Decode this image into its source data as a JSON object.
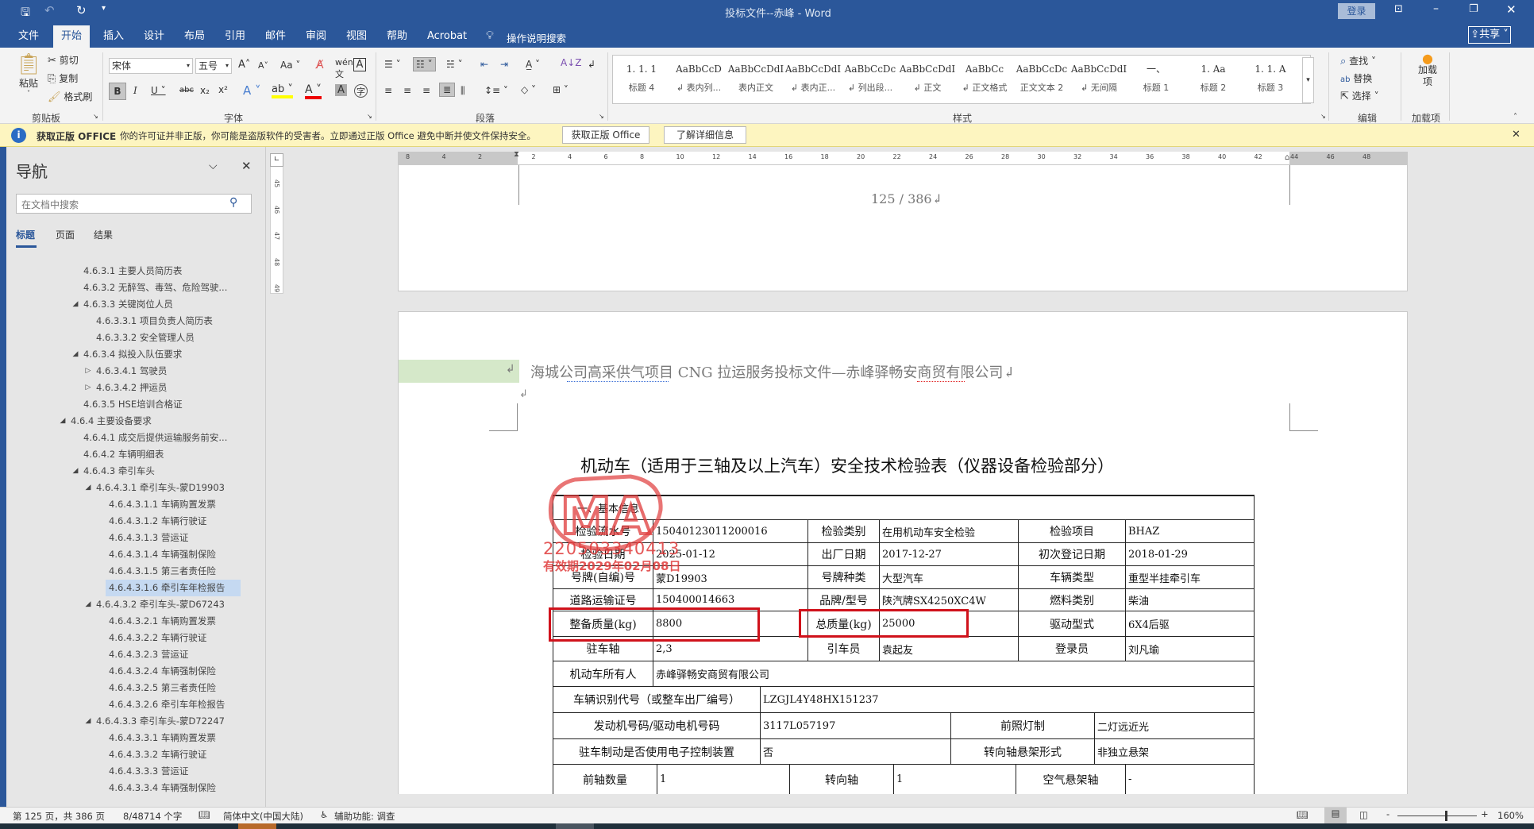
{
  "window": {
    "title": "投标文件--赤峰  -  Word",
    "login": "登录",
    "share": "共享"
  },
  "qat": {
    "save": "save-icon",
    "undo": "undo-icon",
    "redo": "redo-icon"
  },
  "tabs": [
    "文件",
    "开始",
    "插入",
    "设计",
    "布局",
    "引用",
    "邮件",
    "审阅",
    "视图",
    "帮助",
    "Acrobat"
  ],
  "tell_me": "操作说明搜索",
  "ribbon": {
    "clipboard": {
      "paste": "粘贴",
      "cut": "剪切",
      "copy": "复制",
      "format_painter": "格式刷",
      "label": "剪贴板"
    },
    "font": {
      "name": "宋体",
      "size": "五号",
      "label": "字体",
      "change_case": "Aa"
    },
    "paragraph": {
      "label": "段落"
    },
    "styles": {
      "label": "样式",
      "items": [
        {
          "preview": "1. 1. 1",
          "name": "标题 4"
        },
        {
          "preview": "AaBbCcD",
          "name": "↲ 表内列..."
        },
        {
          "preview": "AaBbCcDdI",
          "name": "表内正文"
        },
        {
          "preview": "AaBbCcDdI",
          "name": "↲ 表内正..."
        },
        {
          "preview": "AaBbCcDc",
          "name": "↲ 列出段..."
        },
        {
          "preview": "AaBbCcDdI",
          "name": "↲ 正文"
        },
        {
          "preview": "AaBbCc",
          "name": "↲ 正文格式"
        },
        {
          "preview": "AaBbCcDc",
          "name": "正文文本 2"
        },
        {
          "preview": "AaBbCcDdI",
          "name": "↲ 无间隔"
        },
        {
          "preview": "一、",
          "name": "标题 1"
        },
        {
          "preview": "1.  Aa",
          "name": "标题 2"
        },
        {
          "preview": "1. 1.  A",
          "name": "标题 3"
        }
      ]
    },
    "editing": {
      "find": "查找",
      "replace": "替换",
      "select": "选择",
      "label": "编辑"
    },
    "addins": {
      "button": "加载项",
      "label": "加载项"
    }
  },
  "infobar": {
    "title": "获取正版 OFFICE",
    "message": "你的许可证并非正版，你可能是盗版软件的受害者。立即通过正版 Office 避免中断并使文件保持安全。",
    "btn_get": "获取正版 Office",
    "btn_learn": "了解详细信息"
  },
  "nav": {
    "title": "导航",
    "search_placeholder": "在文档中搜索",
    "tabs": [
      "标题",
      "页面",
      "结果"
    ],
    "items": [
      {
        "text": "4.6.3.1  主要人员简历表",
        "level": 1,
        "arrow": ""
      },
      {
        "text": "4.6.3.2  无醉驾、毒驾、危险驾驶...",
        "level": 1,
        "arrow": ""
      },
      {
        "text": "4.6.3.3  关键岗位人员",
        "level": 1,
        "arrow": "◢"
      },
      {
        "text": "4.6.3.3.1  项目负责人简历表",
        "level": 2,
        "arrow": ""
      },
      {
        "text": "4.6.3.3.2  安全管理人员",
        "level": 2,
        "arrow": ""
      },
      {
        "text": "4.6.3.4  拟投入队伍要求",
        "level": 1,
        "arrow": "◢"
      },
      {
        "text": "4.6.3.4.1  驾驶员",
        "level": 2,
        "arrow": "▷"
      },
      {
        "text": "4.6.3.4.2  押运员",
        "level": 2,
        "arrow": "▷"
      },
      {
        "text": "4.6.3.5  HSE培训合格证",
        "level": 1,
        "arrow": ""
      },
      {
        "text": "4.6.4  主要设备要求",
        "level": 0,
        "arrow": "◢"
      },
      {
        "text": "4.6.4.1  成交后提供运输服务前安...",
        "level": 1,
        "arrow": ""
      },
      {
        "text": "4.6.4.2  车辆明细表",
        "level": 1,
        "arrow": ""
      },
      {
        "text": "4.6.4.3  牵引车头",
        "level": 1,
        "arrow": "◢"
      },
      {
        "text": "4.6.4.3.1  牵引车头-蒙D19903",
        "level": 2,
        "arrow": "◢"
      },
      {
        "text": "4.6.4.3.1.1 车辆购置发票",
        "level": 3,
        "arrow": ""
      },
      {
        "text": "4.6.4.3.1.2 车辆行驶证",
        "level": 3,
        "arrow": ""
      },
      {
        "text": "4.6.4.3.1.3 营运证",
        "level": 3,
        "arrow": ""
      },
      {
        "text": "4.6.4.3.1.4 车辆强制保险",
        "level": 3,
        "arrow": ""
      },
      {
        "text": "4.6.4.3.1.5 第三者责任险",
        "level": 3,
        "arrow": ""
      },
      {
        "text": "4.6.4.3.1.6 牵引车年检报告",
        "level": 3,
        "arrow": "",
        "selected": true
      },
      {
        "text": "4.6.4.3.2  牵引车头-蒙D67243",
        "level": 2,
        "arrow": "◢"
      },
      {
        "text": "4.6.4.3.2.1 车辆购置发票",
        "level": 3,
        "arrow": ""
      },
      {
        "text": "4.6.4.3.2.2 车辆行驶证",
        "level": 3,
        "arrow": ""
      },
      {
        "text": "4.6.4.3.2.3 营运证",
        "level": 3,
        "arrow": ""
      },
      {
        "text": "4.6.4.3.2.4 车辆强制保险",
        "level": 3,
        "arrow": ""
      },
      {
        "text": "4.6.4.3.2.5 第三者责任险",
        "level": 3,
        "arrow": ""
      },
      {
        "text": "4.6.4.3.2.6 牵引车年检报告",
        "level": 3,
        "arrow": ""
      },
      {
        "text": "4.6.4.3.3  牵引车头-蒙D72247",
        "level": 2,
        "arrow": "◢"
      },
      {
        "text": "4.6.4.3.3.1 车辆购置发票",
        "level": 3,
        "arrow": ""
      },
      {
        "text": "4.6.4.3.3.2 车辆行驶证",
        "level": 3,
        "arrow": ""
      },
      {
        "text": "4.6.4.3.3.3 营运证",
        "level": 3,
        "arrow": ""
      },
      {
        "text": "4.6.4.3.3.4 车辆强制保险",
        "level": 3,
        "arrow": ""
      }
    ]
  },
  "ruler": [
    "8",
    "4",
    "2",
    "2",
    "4",
    "6",
    "8",
    "10",
    "12",
    "14",
    "16",
    "18",
    "20",
    "22",
    "24",
    "26",
    "28",
    "30",
    "32",
    "34",
    "36",
    "38",
    "40",
    "42",
    "44",
    "46",
    "48"
  ],
  "vruler": [
    "45",
    "46",
    "47",
    "48",
    "49"
  ],
  "document": {
    "page_number": "125  /  386↲",
    "header": "海城公司高采供气项目 CNG 拉运服务投标文件—赤峰驿畅安商贸有限公司↲",
    "table_title": "机动车（适用于三轴及以上汽车）安全技术检验表（仪器设备检验部分）",
    "stamp": {
      "letters": "MA",
      "number": "220503340413",
      "valid": "有效期2029年02月08日"
    },
    "section": "一、基本信息",
    "rows6": [
      [
        "检验流水号",
        "15040123011200016",
        "检验类别",
        "在用机动车安全检验",
        "检验项目",
        "BHAZ"
      ],
      [
        "检验日期",
        "2025-01-12",
        "出厂日期",
        "2017-12-27",
        "初次登记日期",
        "2018-01-29"
      ],
      [
        "号牌(自编)号",
        "蒙D19903",
        "号牌种类",
        "大型汽车",
        "车辆类型",
        "重型半挂牵引车"
      ],
      [
        "道路运输证号",
        "150400014663",
        "品牌/型号",
        "陕汽牌SX4250XC4W",
        "燃料类别",
        "柴油"
      ],
      [
        "整备质量(kg)",
        "8800",
        "总质量(kg)",
        "25000",
        "驱动型式",
        "6X4后驱"
      ],
      [
        "驻车轴",
        "2,3",
        "引车员",
        "袁起友",
        "登录员",
        "刘凡瑜"
      ]
    ],
    "owner": [
      "机动车所有人",
      "赤峰驿畅安商贸有限公司"
    ],
    "vin": [
      "车辆识别代号（或整车出厂编号）",
      "LZGJL4Y48HX151237"
    ],
    "engine": [
      "发动机号码/驱动电机号码",
      "3117L057197",
      "前照灯制",
      "二灯远近光"
    ],
    "brake": [
      "驻车制动是否使用电子控制装置",
      "否",
      "转向轴悬架形式",
      "非独立悬架"
    ],
    "axle": [
      "前轴数量",
      "1",
      "转向轴",
      "1",
      "空气悬架轴",
      "-"
    ]
  },
  "status": {
    "page": "第 125 页，共 386 页",
    "words": "8/48714 个字",
    "language": "简体中文(中国大陆)",
    "accessibility": "辅助功能: 调查",
    "zoom": "160%",
    "zoom_level": 0.6
  }
}
